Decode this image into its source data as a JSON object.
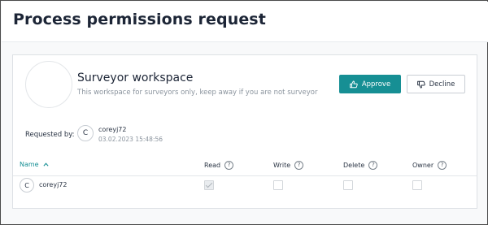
{
  "page": {
    "title": "Process permissions request"
  },
  "workspace": {
    "name": "Surveyor workspace",
    "description": "This workspace for surveyors only, keep away if you are not surveyor"
  },
  "actions": {
    "approve_label": "Approve",
    "decline_label": "Decline",
    "approve_icon": "thumbs-up-icon",
    "decline_icon": "thumbs-down-icon",
    "accent_color": "#168f94"
  },
  "request": {
    "label": "Requested by:",
    "avatar_letter": "C",
    "user": "coreyj72",
    "date": "03.02.2023 15:48:56"
  },
  "table": {
    "columns": {
      "name": "Name",
      "read": "Read",
      "write": "Write",
      "delete": "Delete",
      "owner": "Owner"
    },
    "sort_icon": "sort-ascending-icon",
    "help_icon": "question-circle-icon",
    "rows": [
      {
        "avatar_letter": "C",
        "name": "coreyj72",
        "read": true,
        "write": false,
        "delete": false,
        "owner": false
      }
    ]
  }
}
